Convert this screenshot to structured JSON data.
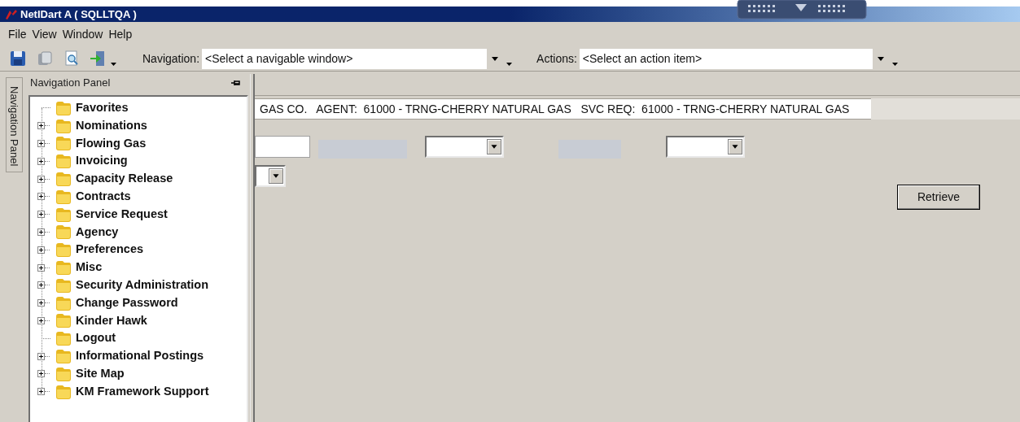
{
  "window": {
    "title": "NetIDart A ( SQLLTQA )"
  },
  "menu": [
    "File",
    "View",
    "Window",
    "Help"
  ],
  "toolbar": {
    "navigation": {
      "label": "Navigation:",
      "value": "<Select a navigable window>"
    },
    "actions": {
      "label": "Actions:",
      "value": "<Select an action item>"
    }
  },
  "side_tab": {
    "label": "Navigation Panel",
    "selected": true
  },
  "navigation_panel": {
    "title": "Navigation Panel",
    "items": [
      {
        "label": "Favorites",
        "expandable": false
      },
      {
        "label": "Nominations",
        "expandable": true
      },
      {
        "label": "Flowing Gas",
        "expandable": true
      },
      {
        "label": "Invoicing",
        "expandable": true
      },
      {
        "label": "Capacity Release",
        "expandable": true
      },
      {
        "label": "Contracts",
        "expandable": true
      },
      {
        "label": "Service Request",
        "expandable": true
      },
      {
        "label": "Agency",
        "expandable": true
      },
      {
        "label": "Preferences",
        "expandable": true
      },
      {
        "label": "Misc",
        "expandable": true
      },
      {
        "label": "Security Administration",
        "expandable": true
      },
      {
        "label": "Change Password",
        "expandable": true
      },
      {
        "label": "Kinder Hawk",
        "expandable": true
      },
      {
        "label": "Logout",
        "expandable": false
      },
      {
        "label": "Informational Postings",
        "expandable": true
      },
      {
        "label": "Site Map",
        "expandable": true
      },
      {
        "label": "KM Framework Support",
        "expandable": true
      }
    ]
  },
  "info_bar": "GAS CO.   AGENT:  61000 - TRNG-CHERRY NATURAL GAS   SVC REQ:  61000 - TRNG-CHERRY NATURAL GAS",
  "form": {
    "row_1": [
      {
        "kind": "text"
      },
      {
        "kind": "disabled"
      },
      {
        "kind": "combo"
      },
      {
        "kind": "disabled"
      },
      {
        "kind": "combo"
      }
    ],
    "row_2": [
      {
        "kind": "combo"
      }
    ],
    "button": "Retrieve"
  }
}
